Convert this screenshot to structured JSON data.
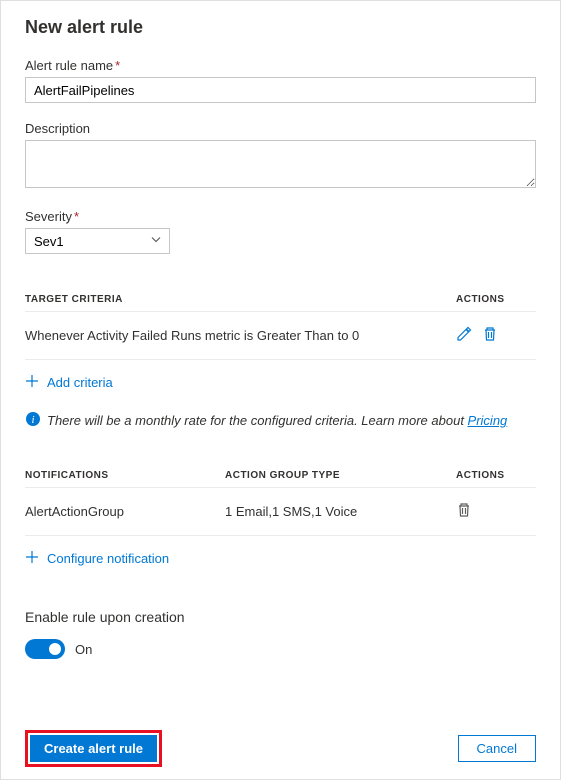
{
  "page_title": "New alert rule",
  "fields": {
    "name": {
      "label": "Alert rule name",
      "required": true,
      "value": "AlertFailPipelines"
    },
    "description": {
      "label": "Description",
      "value": ""
    },
    "severity": {
      "label": "Severity",
      "required": true,
      "selected": "Sev1"
    }
  },
  "criteria_section": {
    "header_criteria": "TARGET CRITERIA",
    "header_actions": "ACTIONS",
    "rows": [
      {
        "text": "Whenever Activity Failed Runs metric is Greater Than to 0"
      }
    ],
    "add_label": "Add criteria",
    "info_text": "There will be a monthly rate for the configured criteria. Learn more about ",
    "info_link_label": "Pricing"
  },
  "notifications_section": {
    "header_notifications": "NOTIFICATIONS",
    "header_group_type": "ACTION GROUP TYPE",
    "header_actions": "ACTIONS",
    "rows": [
      {
        "name": "AlertActionGroup",
        "type": "1 Email,1 SMS,1 Voice"
      }
    ],
    "configure_label": "Configure notification"
  },
  "enable_section": {
    "label": "Enable rule upon creation",
    "state_label": "On",
    "enabled": true
  },
  "footer": {
    "create_label": "Create alert rule",
    "cancel_label": "Cancel"
  }
}
